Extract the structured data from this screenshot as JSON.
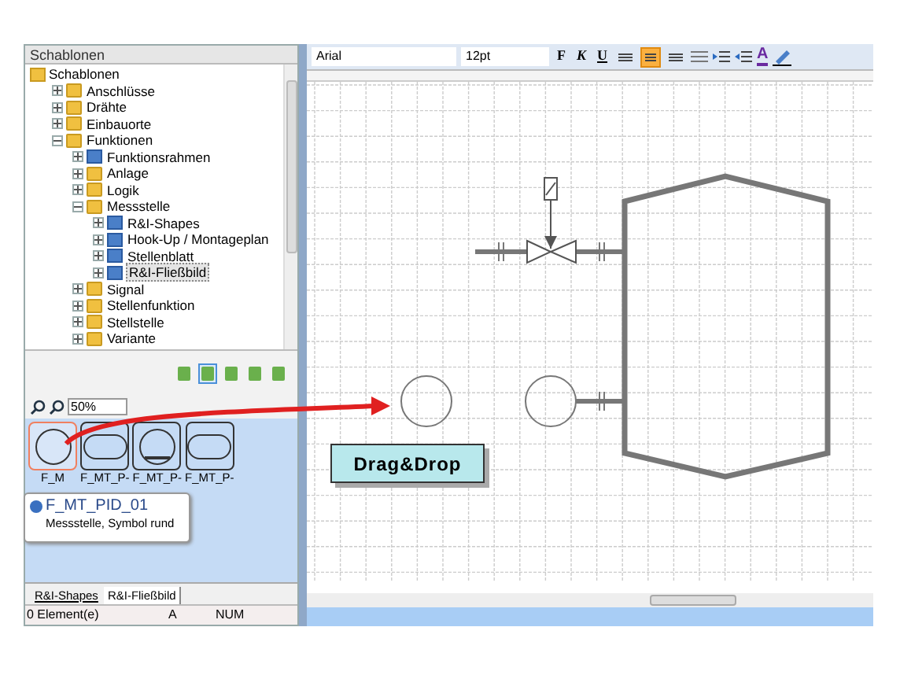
{
  "stencil_panel": {
    "title": "Schablonen",
    "tree": {
      "root_label": "Schablonen",
      "children": [
        {
          "label": "Anschlüsse",
          "kind": "folder",
          "expanded": false,
          "selected": false
        },
        {
          "label": "Drähte",
          "kind": "folder",
          "expanded": false,
          "selected": false
        },
        {
          "label": "Einbauorte",
          "kind": "folder",
          "expanded": false,
          "selected": false
        },
        {
          "label": "Funktionen",
          "kind": "folder",
          "expanded": true,
          "selected": false,
          "children": [
            {
              "label": "Funktionsrahmen",
              "kind": "stencil",
              "expanded": false,
              "selected": false
            },
            {
              "label": "Anlage",
              "kind": "folder",
              "expanded": false,
              "selected": false
            },
            {
              "label": "Logik",
              "kind": "folder",
              "expanded": false,
              "selected": false
            },
            {
              "label": "Messstelle",
              "kind": "folder",
              "expanded": true,
              "selected": false,
              "children": [
                {
                  "label": "R&I-Shapes",
                  "kind": "stencil",
                  "expanded": false,
                  "selected": false
                },
                {
                  "label": "Hook-Up / Montageplan",
                  "kind": "stencil",
                  "expanded": false,
                  "selected": false
                },
                {
                  "label": "Stellenblatt",
                  "kind": "stencil",
                  "expanded": false,
                  "selected": false
                },
                {
                  "label": "R&I-Fließbild",
                  "kind": "stencil",
                  "expanded": false,
                  "selected": true
                }
              ]
            },
            {
              "label": "Signal",
              "kind": "folder",
              "expanded": false,
              "selected": false
            },
            {
              "label": "Stellenfunktion",
              "kind": "folder",
              "expanded": false,
              "selected": false
            },
            {
              "label": "Stellstelle",
              "kind": "folder",
              "expanded": false,
              "selected": false
            },
            {
              "label": "Variante",
              "kind": "folder",
              "expanded": false,
              "selected": false
            }
          ]
        }
      ]
    },
    "view_buttons": [
      {
        "selected": false
      },
      {
        "selected": true
      },
      {
        "selected": false
      },
      {
        "selected": false
      },
      {
        "selected": false
      }
    ],
    "zoom": {
      "value": "50%"
    },
    "shapes": [
      {
        "label": "F_M",
        "kind": "circle",
        "selected": true
      },
      {
        "label": "F_MT_P-",
        "kind": "oval",
        "selected": false
      },
      {
        "label": "F_MT_P-",
        "kind": "circle-bar",
        "selected": false
      },
      {
        "label": "F_MT_P-",
        "kind": "oval",
        "selected": false
      }
    ],
    "tooltip": {
      "title": "F_MT_PID_01",
      "description": "Messstelle, Symbol rund"
    },
    "tabs": [
      {
        "label": "R&I-Shapes",
        "selected": false
      },
      {
        "label": "R&I-Fließbild",
        "selected": true
      }
    ],
    "status_bar": {
      "elements": "0 Element(e)",
      "font_indicator": "A",
      "num_lock": "NUM"
    }
  },
  "format_toolbar": {
    "font": "Arial",
    "size": "12pt",
    "bold": "F",
    "italic": "K",
    "underline": "U",
    "align": [
      {
        "selected": false
      },
      {
        "selected": true
      },
      {
        "selected": false
      }
    ],
    "font_color_letter": "A"
  },
  "canvas": {
    "callout": "Drag&Drop"
  }
}
